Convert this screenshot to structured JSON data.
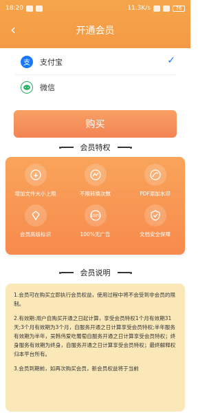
{
  "status_bar": {
    "time": "18:20",
    "speed": "11.3K/s",
    "battery": "76"
  },
  "header": {
    "title": "开通会员"
  },
  "payment_methods": [
    {
      "label": "支付宝",
      "selected": true,
      "icon": "alipay-icon"
    },
    {
      "label": "微信",
      "selected": false,
      "icon": "wechat-icon"
    }
  ],
  "buy_button": {
    "label": "购买"
  },
  "privileges": {
    "title": "会员特权",
    "items": [
      {
        "label": "增加文件大小上限",
        "icon": "file-size-icon"
      },
      {
        "label": "不限转换次数",
        "icon": "unlimited-icon"
      },
      {
        "label": "PDF添加水印",
        "icon": "watermark-icon"
      },
      {
        "label": "会员高级标识",
        "icon": "premium-badge-icon"
      },
      {
        "label": "100%无广告",
        "icon": "no-ads-icon"
      },
      {
        "label": "文档安全保障",
        "icon": "security-shield-icon"
      }
    ]
  },
  "notes": {
    "title": "会员说明",
    "paragraphs": [
      "1.会员可在购买立即执行会员权益，使用过程中将不会受到非会员的限制。",
      "2.有效期:用户自购买开通之日起计算，享受会员特权1个月有效期31天;3个月有效期为3个月，自服务开通之日计算享受会员特权;半年服务有效期为半年，吴韩伟爱吃葡萄自服务开通之日计算享受会员特权；终身服务有效期为终身，自服务开通之日计算享受会员特权；最终解释权归本平台所有。",
      "3.会员到期前，如再次购买会员，新会员权益将于当前"
    ]
  },
  "colors": {
    "accent": "#f49a45",
    "button": "#f28454",
    "alipay": "#1677ff",
    "wechat": "#2aae67",
    "notes_bg": "#fbe8b9"
  }
}
